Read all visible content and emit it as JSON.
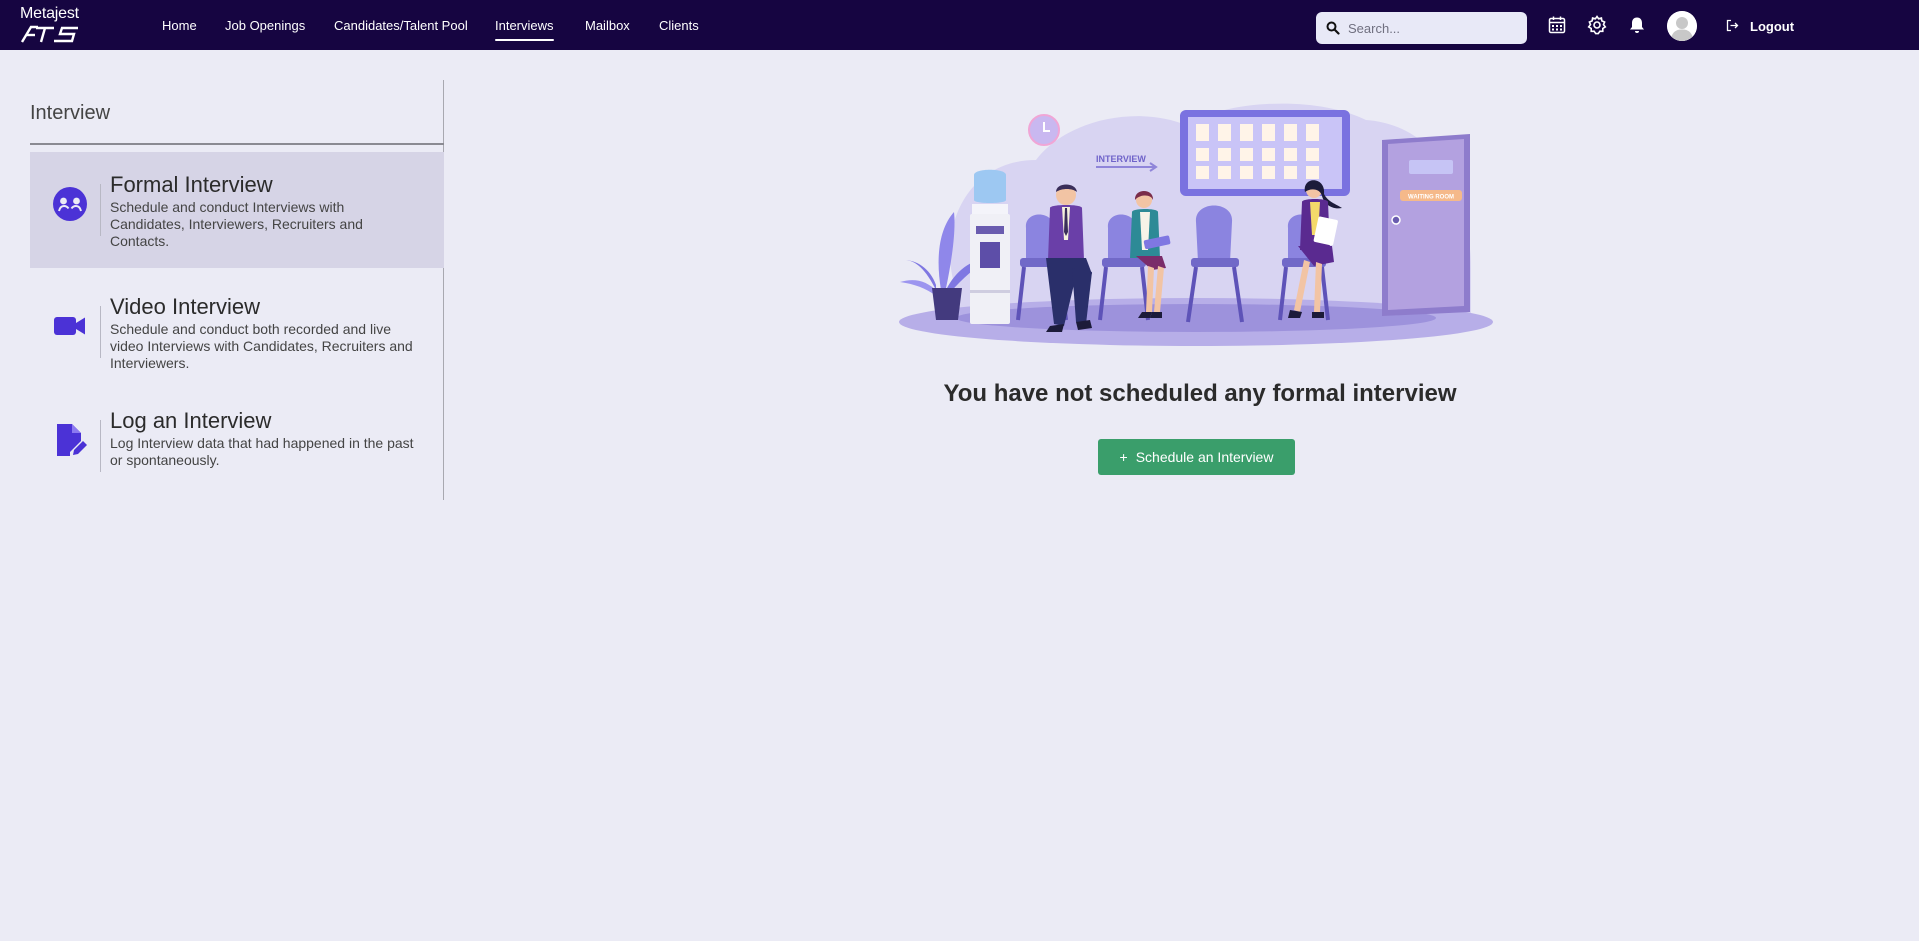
{
  "brand": {
    "name_top": "Metajest",
    "name_bottom": "ATS"
  },
  "nav": {
    "items": [
      {
        "label": "Home",
        "active": false
      },
      {
        "label": "Job Openings",
        "active": false
      },
      {
        "label": "Candidates/Talent Pool",
        "active": false
      },
      {
        "label": "Interviews",
        "active": true
      },
      {
        "label": "Mailbox",
        "active": false
      },
      {
        "label": "Clients",
        "active": false
      }
    ]
  },
  "header": {
    "search_placeholder": "Search...",
    "search_value": "",
    "icons": [
      "calendar-icon",
      "gear-icon",
      "bell-icon",
      "avatar"
    ],
    "logout_label": "Logout"
  },
  "sidebar": {
    "heading": "Interview",
    "items": [
      {
        "icon": "user-group-icon",
        "title": "Formal Interview",
        "description": "Schedule and conduct Interviews with Candidates, Interviewers, Recruiters and Contacts.",
        "active": true
      },
      {
        "icon": "video-camera-icon",
        "title": "Video Interview",
        "description": "Schedule and conduct both recorded and live video Interviews with Candidates, Recruiters and Interviewers.",
        "active": false
      },
      {
        "icon": "file-edit-icon",
        "title": "Log an Interview",
        "description": "Log Interview data that had happened in the past or spontaneously.",
        "active": false
      }
    ]
  },
  "main": {
    "illustration": {
      "sign_text": "INTERVIEW",
      "door_text": "WAITING ROOM"
    },
    "empty_message": "You have not scheduled any formal interview",
    "schedule_button": {
      "icon": "+",
      "label": "Schedule an Interview"
    }
  },
  "colors": {
    "topbar": "#160541",
    "background": "#ebebf5",
    "accent": "#4b32d6",
    "button": "#3a9e6b",
    "active_item": "#d6d4e6"
  }
}
